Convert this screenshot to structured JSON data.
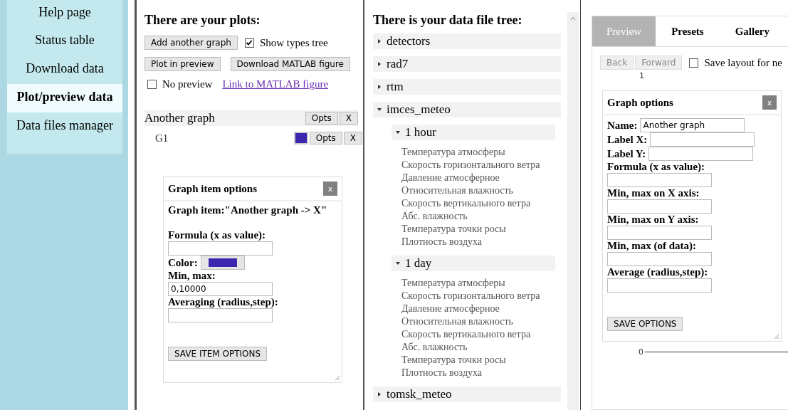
{
  "sidebar": {
    "items": [
      {
        "label": "Help page",
        "selected": false
      },
      {
        "label": "Status table",
        "selected": false
      },
      {
        "label": "Download data",
        "selected": false
      },
      {
        "label": "Plot/preview data",
        "selected": true
      },
      {
        "label": "Data files manager",
        "selected": false
      }
    ]
  },
  "plots": {
    "title": "There are your plots:",
    "add_button": "Add another graph",
    "show_types_tree": {
      "label": "Show types tree",
      "checked": true
    },
    "plot_button": "Plot in preview",
    "download_button": "Download MATLAB figure",
    "no_preview": {
      "label": "No preview",
      "checked": false
    },
    "link": "Link to MATLAB figure",
    "graphs": [
      {
        "name": "Another graph",
        "opts": "Opts",
        "remove": "X",
        "items": [
          {
            "name": "G1",
            "color": "#3b26b0",
            "opts": "Opts",
            "remove": "X"
          }
        ]
      }
    ],
    "item_options": {
      "title": "Graph item options",
      "close": "x",
      "heading": "Graph item:\"Another graph -> X\"",
      "fields": [
        {
          "kind": "text",
          "label": "Formula (x as value):"
        },
        {
          "kind": "color",
          "label": "Color:",
          "color": "#3b26b0"
        },
        {
          "kind": "text",
          "label": "Min, max:",
          "value": "0,10000"
        },
        {
          "kind": "text",
          "label": "Averaging (radius,step):"
        }
      ],
      "save": "SAVE ITEM OPTIONS"
    }
  },
  "tree": {
    "title": "There is your data file tree:",
    "nodes": [
      {
        "label": "detectors",
        "expanded": false
      },
      {
        "label": "rad7",
        "expanded": false
      },
      {
        "label": "rtm",
        "expanded": false
      },
      {
        "label": "imces_meteo",
        "expanded": true,
        "children": [
          {
            "label": "1 hour",
            "expanded": true,
            "children": [
              {
                "label": "Температура атмосферы"
              },
              {
                "label": "Скорость горизонтального ветра"
              },
              {
                "label": "Давление атмосферное"
              },
              {
                "label": "Относительная влажность"
              },
              {
                "label": "Скорость вертикального ветра"
              },
              {
                "label": "Абс. влажность"
              },
              {
                "label": "Температура точки росы"
              },
              {
                "label": "Плотность воздуха"
              }
            ]
          },
          {
            "label": "1 day",
            "expanded": true,
            "children": [
              {
                "label": "Температура атмосферы"
              },
              {
                "label": "Скорость горизонтального ветра"
              },
              {
                "label": "Давление атмосферное"
              },
              {
                "label": "Относительная влажность"
              },
              {
                "label": "Скорость вертикального ветра"
              },
              {
                "label": "Абс. влажность"
              },
              {
                "label": "Температура точки росы"
              },
              {
                "label": "Плотность воздуха"
              }
            ]
          }
        ]
      },
      {
        "label": "tomsk_meteo",
        "expanded": false
      }
    ]
  },
  "preview": {
    "tabs": [
      {
        "label": "Preview",
        "selected": true
      },
      {
        "label": "Presets",
        "selected": false
      },
      {
        "label": "Gallery",
        "selected": false
      }
    ],
    "back": {
      "label": "Back",
      "disabled": true
    },
    "forward": {
      "label": "Forward",
      "disabled": true
    },
    "save_layout": {
      "label": "Save layout for ne",
      "checked": false
    },
    "page": "1",
    "graph_options": {
      "title": "Graph options",
      "close": "x",
      "fields": [
        {
          "kind": "inline",
          "label": "Name:",
          "value": "Another graph"
        },
        {
          "kind": "inline",
          "label": "Label X:"
        },
        {
          "kind": "inline",
          "label": "Label Y:"
        },
        {
          "kind": "block",
          "label": "Formula (x as value):"
        },
        {
          "kind": "block",
          "label": "Min, max on X axis:"
        },
        {
          "kind": "block",
          "label": "Min, max on Y axis:"
        },
        {
          "kind": "block",
          "label": "Min, max (of data):"
        },
        {
          "kind": "block",
          "label": "Average (radius,step):"
        }
      ],
      "save": "SAVE OPTIONS"
    },
    "axis_label": "0"
  }
}
